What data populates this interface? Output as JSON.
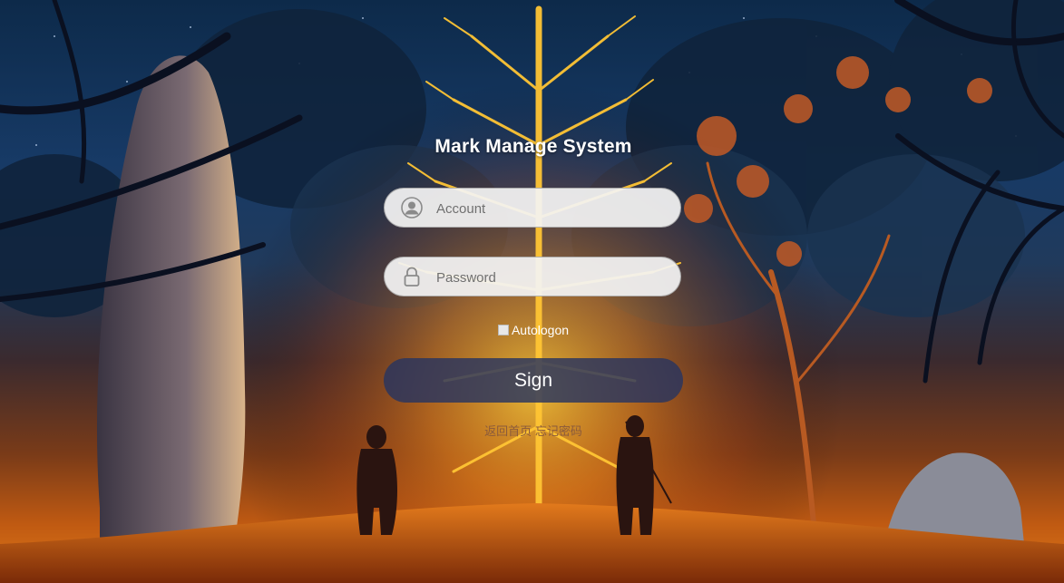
{
  "app": {
    "title": "Mark Manage System"
  },
  "login": {
    "account": {
      "placeholder": "Account",
      "value": "",
      "icon": "user-icon"
    },
    "password": {
      "placeholder": "Password",
      "value": "",
      "icon": "lock-icon"
    },
    "autologon": {
      "label": "Autologon",
      "checked": false
    },
    "sign_label": "Sign",
    "links": {
      "home": "返回首页",
      "forgot": "忘记密码"
    }
  },
  "colors": {
    "title": "#ffffff",
    "sign_button_bg": "#28345f",
    "field_bg": "#f3f3f3",
    "link_text": "#8a5a3c"
  }
}
